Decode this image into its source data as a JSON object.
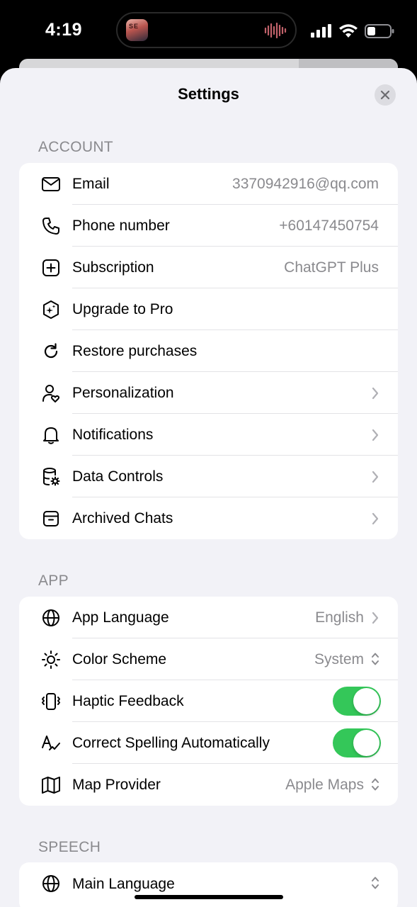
{
  "status_bar": {
    "time": "4:19",
    "island_app_text": "SE"
  },
  "sheet": {
    "title": "Settings"
  },
  "sections": {
    "account": {
      "header": "ACCOUNT",
      "items": [
        {
          "label": "Email",
          "value": "3370942916@qq.com",
          "icon": "mail-icon"
        },
        {
          "label": "Phone number",
          "value": "+60147450754",
          "icon": "phone-icon"
        },
        {
          "label": "Subscription",
          "value": "ChatGPT Plus",
          "icon": "plus-square-icon"
        },
        {
          "label": "Upgrade to Pro",
          "icon": "sparkle-hexagon-icon"
        },
        {
          "label": "Restore purchases",
          "icon": "refresh-icon"
        },
        {
          "label": "Personalization",
          "icon": "person-heart-icon"
        },
        {
          "label": "Notifications",
          "icon": "bell-icon"
        },
        {
          "label": "Data Controls",
          "icon": "database-gear-icon"
        },
        {
          "label": "Archived Chats",
          "icon": "archive-icon"
        }
      ]
    },
    "app": {
      "header": "APP",
      "items": [
        {
          "label": "App Language",
          "value": "English",
          "icon": "globe-icon"
        },
        {
          "label": "Color Scheme",
          "value": "System",
          "icon": "sun-icon"
        },
        {
          "label": "Haptic Feedback",
          "toggle": true,
          "icon": "vibrate-icon"
        },
        {
          "label": "Correct Spelling Automatically",
          "toggle": true,
          "icon": "spellcheck-icon"
        },
        {
          "label": "Map Provider",
          "value": "Apple Maps",
          "icon": "map-icon"
        }
      ]
    },
    "speech": {
      "header": "SPEECH",
      "items": [
        {
          "label": "Main Language",
          "icon": "globe-icon"
        }
      ]
    }
  },
  "colors": {
    "toggle_on": "#34c759",
    "secondary_text": "#8a8a8e",
    "background": "#f2f2f7"
  }
}
